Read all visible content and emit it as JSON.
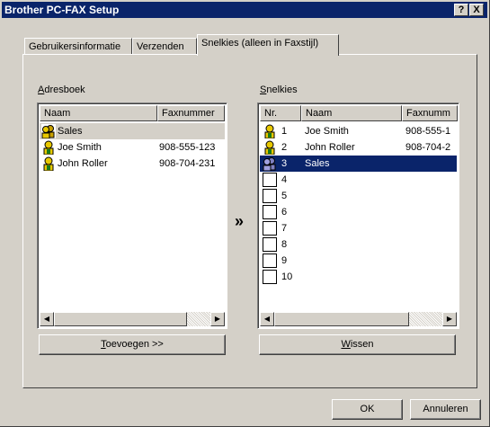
{
  "window": {
    "title": "Brother PC-FAX Setup",
    "help_btn": "?",
    "close_btn": "X"
  },
  "tabs": [
    {
      "label": "Gebruikersinformatie"
    },
    {
      "label": "Verzenden"
    },
    {
      "label": "Snelkies (alleen in Faxstijl)"
    }
  ],
  "address_book": {
    "label": "Adresboek",
    "col_name": "Naam",
    "col_fax": "Faxnummer",
    "rows": [
      {
        "name": "Sales",
        "fax": "",
        "icon": "group-icon"
      },
      {
        "name": "Joe Smith",
        "fax": "908-555-123",
        "icon": "person-icon"
      },
      {
        "name": "John Roller",
        "fax": "908-704-231",
        "icon": "person-icon"
      }
    ],
    "add_button": "Toevoegen >>"
  },
  "transfer_symbol": "»",
  "speed_dial": {
    "label": "Snelkies",
    "col_nr": "Nr.",
    "col_name": "Naam",
    "col_fax": "Faxnumm",
    "rows": [
      {
        "nr": "1",
        "name": "Joe Smith",
        "fax": "908-555-1",
        "icon": "person-icon"
      },
      {
        "nr": "2",
        "name": "John Roller",
        "fax": "908-704-2",
        "icon": "person-icon"
      },
      {
        "nr": "3",
        "name": "Sales",
        "fax": "",
        "icon": "group-icon",
        "selected": true
      },
      {
        "nr": "4",
        "name": "",
        "fax": ""
      },
      {
        "nr": "5",
        "name": "",
        "fax": ""
      },
      {
        "nr": "6",
        "name": "",
        "fax": ""
      },
      {
        "nr": "7",
        "name": "",
        "fax": ""
      },
      {
        "nr": "8",
        "name": "",
        "fax": ""
      },
      {
        "nr": "9",
        "name": "",
        "fax": ""
      },
      {
        "nr": "10",
        "name": "",
        "fax": ""
      }
    ],
    "clear_button": "Wissen"
  },
  "footer": {
    "ok": "OK",
    "cancel": "Annuleren"
  },
  "colors": {
    "titlebar": "#0a246a",
    "selection": "#0a246a",
    "face": "#d4d0c8"
  }
}
